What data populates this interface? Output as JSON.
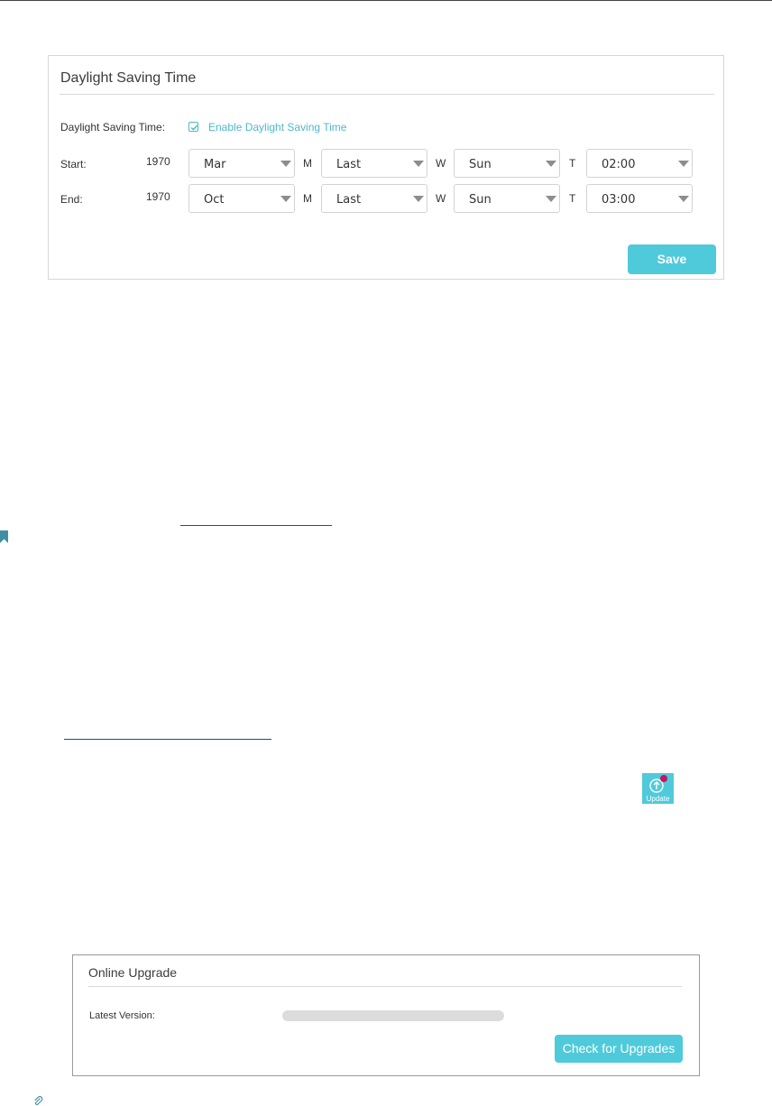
{
  "dst": {
    "title": "Daylight Saving Time",
    "dst_label": "Daylight Saving Time:",
    "checkbox_checked": true,
    "checkbox_label": "Enable Daylight Saving Time",
    "start": {
      "label": "Start:",
      "year": "1970",
      "month": "Mar",
      "week": "Last",
      "day": "Sun",
      "time": "02:00"
    },
    "end": {
      "label": "End:",
      "year": "1970",
      "month": "Oct",
      "week": "Last",
      "day": "Sun",
      "time": "03:00"
    },
    "unit_m": "M",
    "unit_w": "W",
    "unit_t": "T",
    "save_label": "Save"
  },
  "update_icon": {
    "label": "Update",
    "badge": "1"
  },
  "upgrade": {
    "title": "Online Upgrade",
    "latest_label": "Latest Version:",
    "check_label": "Check for Upgrades"
  },
  "colors": {
    "accent": "#4fcadb",
    "link": "#4fb9c9",
    "badge": "#c2185b"
  }
}
